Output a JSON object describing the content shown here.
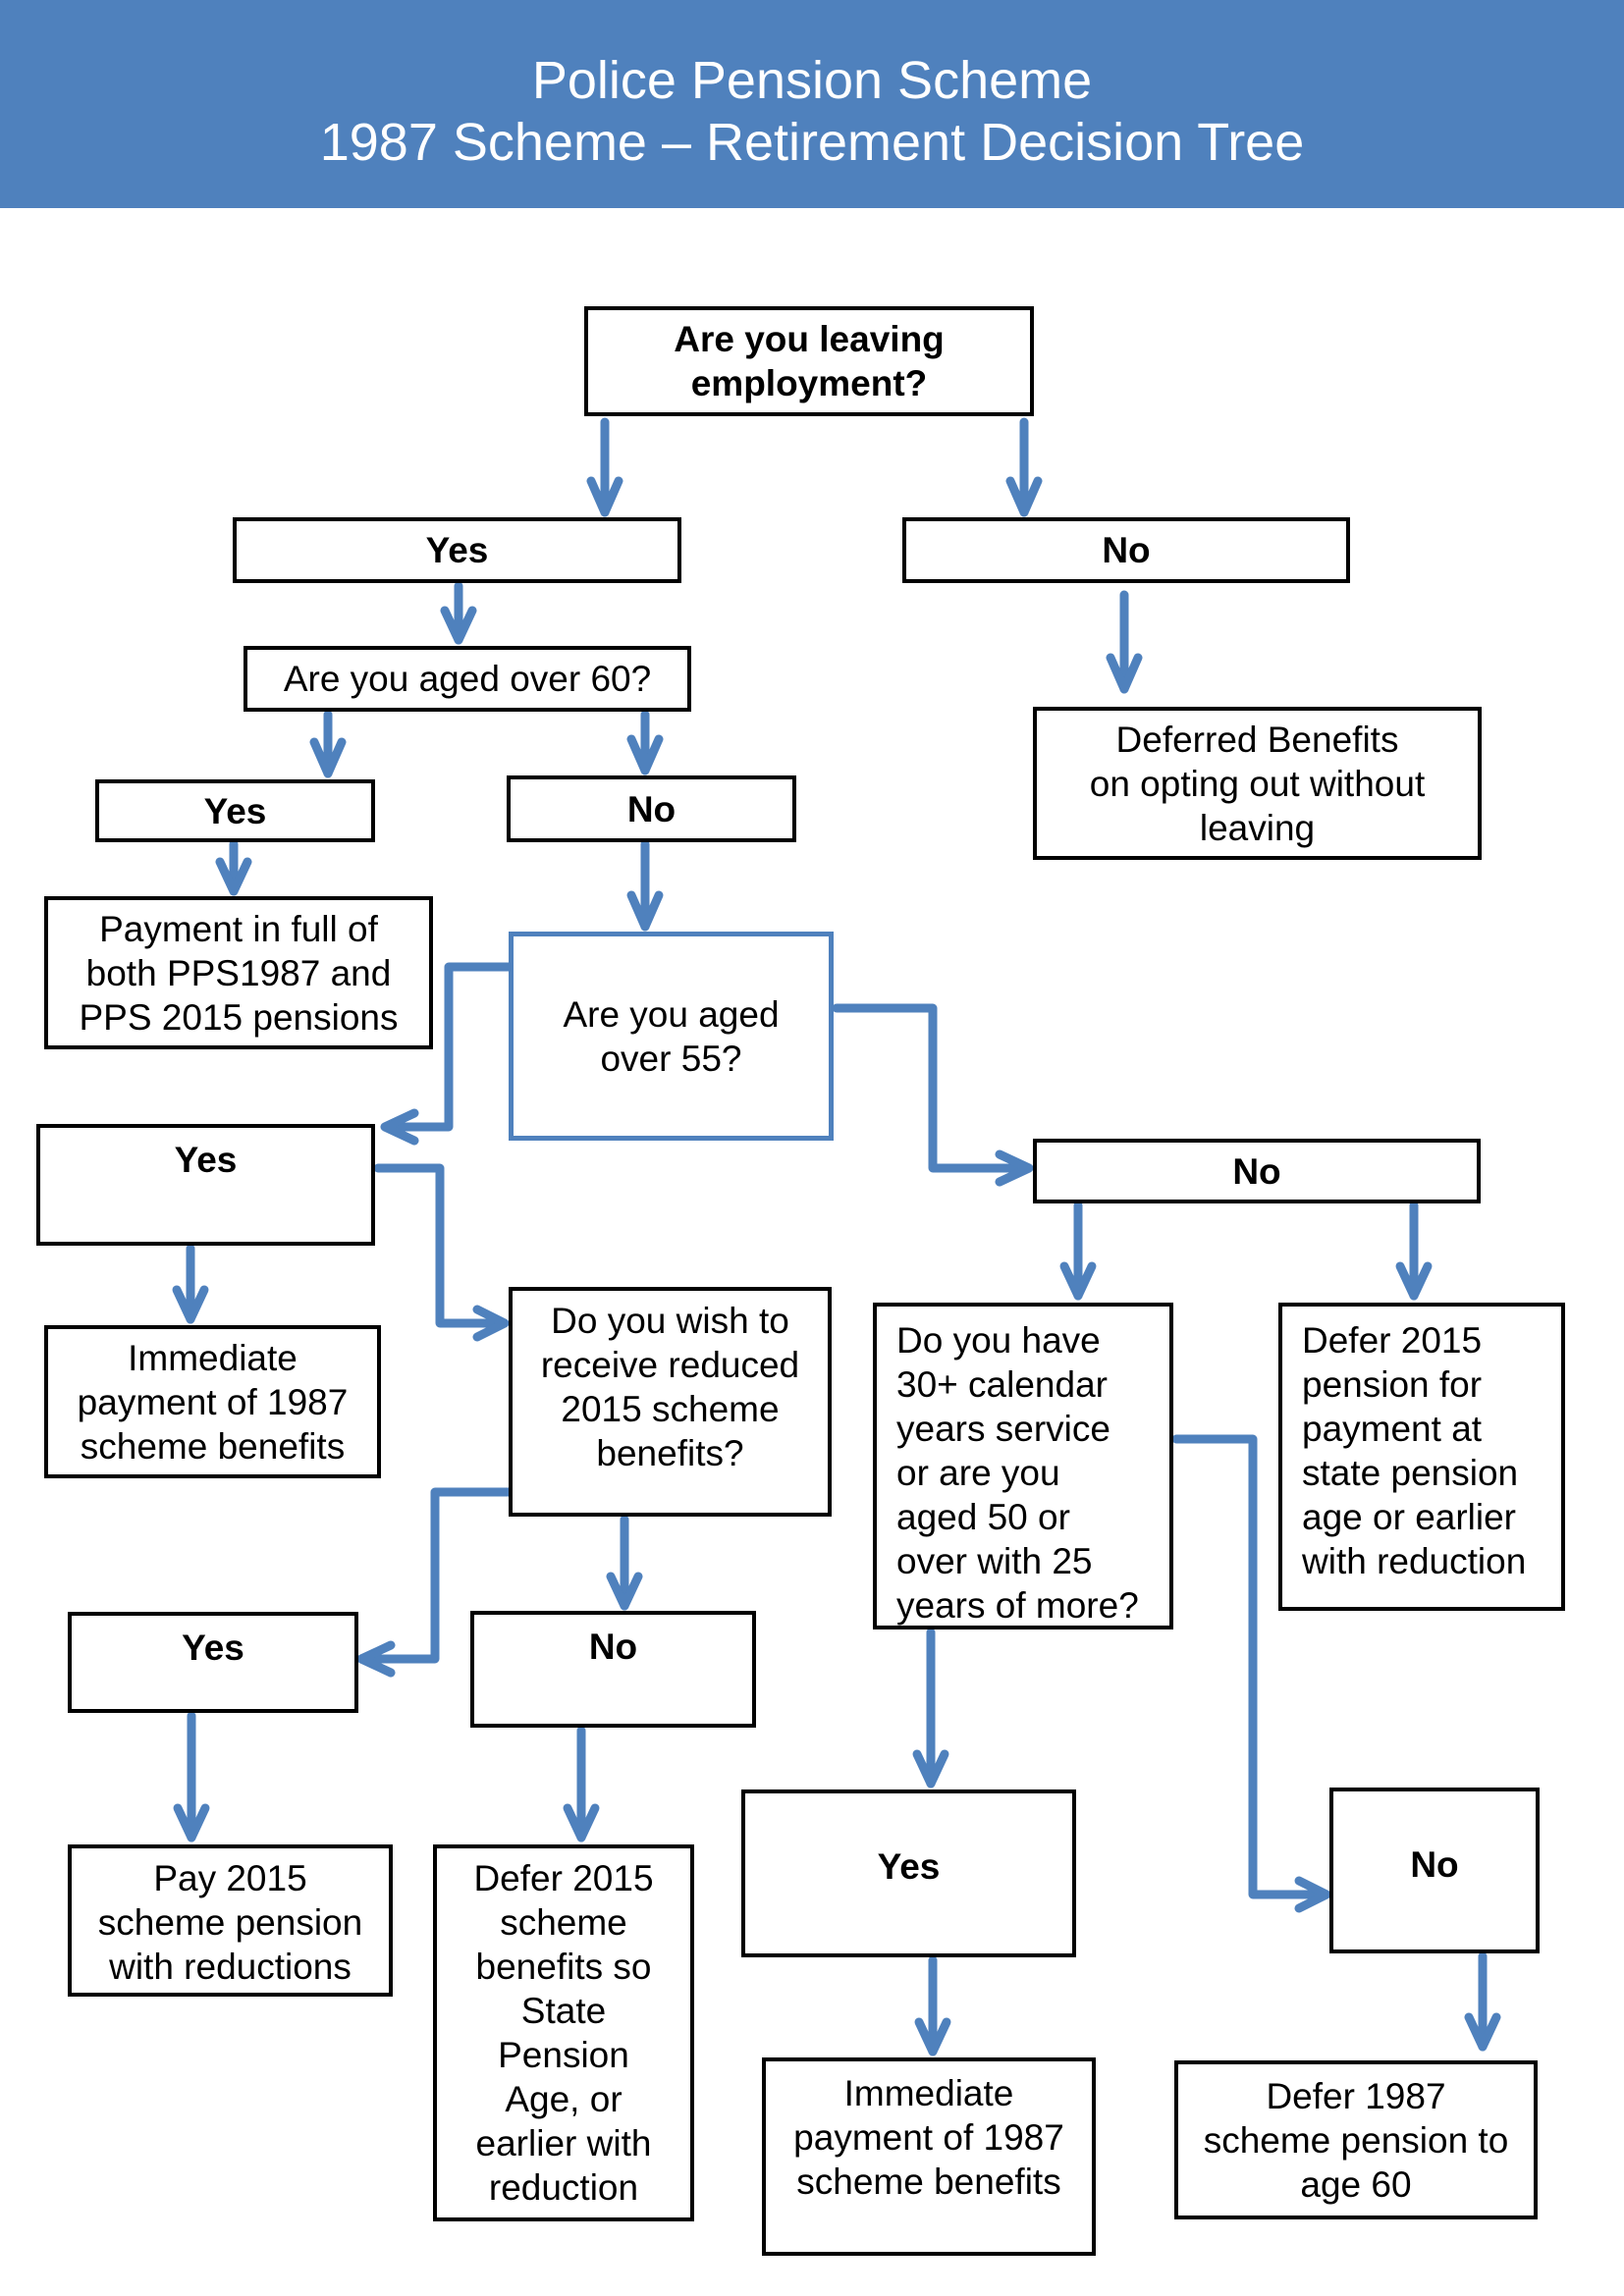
{
  "header": {
    "title_line1": "Police Pension Scheme",
    "title_line2": "1987 Scheme – Retirement Decision Tree",
    "background_color": "#4F81BD"
  },
  "colors": {
    "connector": "#4F81BD",
    "box_border": "#000000",
    "highlight_border": "#4F81BD"
  },
  "nodes": {
    "leaving_employment": "Are you leaving\nemployment?",
    "yes_leaving": "Yes",
    "no_leaving": "No",
    "aged_over_60": "Are you aged over 60?",
    "deferred_benefits": "Deferred Benefits\non opting out without\nleaving",
    "yes_over_60": "Yes",
    "no_over_60": "No",
    "payment_in_full": "Payment in full of\nboth PPS1987 and\nPPS 2015 pensions",
    "aged_over_55": "Are you aged\nover 55?",
    "yes_over_55": "Yes",
    "no_over_55": "No",
    "immediate_1987_left": "Immediate\npayment of 1987\nscheme benefits",
    "wish_reduced_2015": "Do you wish to\nreceive reduced\n2015 scheme\nbenefits?",
    "service_question": "Do you have\n30+ calendar\nyears service\nor are you\naged 50 or\nover with 25\nyears of more?",
    "defer_2015_pension_spa": "Defer 2015\npension for\npayment at\nstate pension\nage or earlier\nwith reduction",
    "yes_reduced": "Yes",
    "no_reduced": "No",
    "pay_2015_reduced": "Pay 2015\nscheme pension\nwith reductions",
    "defer_2015_scheme": "Defer 2015\nscheme\nbenefits so\nState\nPension\nAge, or\nearlier with\nreduction",
    "yes_service": "Yes",
    "no_service": "No",
    "immediate_1987_right": "Immediate\npayment of 1987\nscheme benefits",
    "defer_1987_to_60": "Defer 1987\nscheme pension to\nage 60"
  }
}
